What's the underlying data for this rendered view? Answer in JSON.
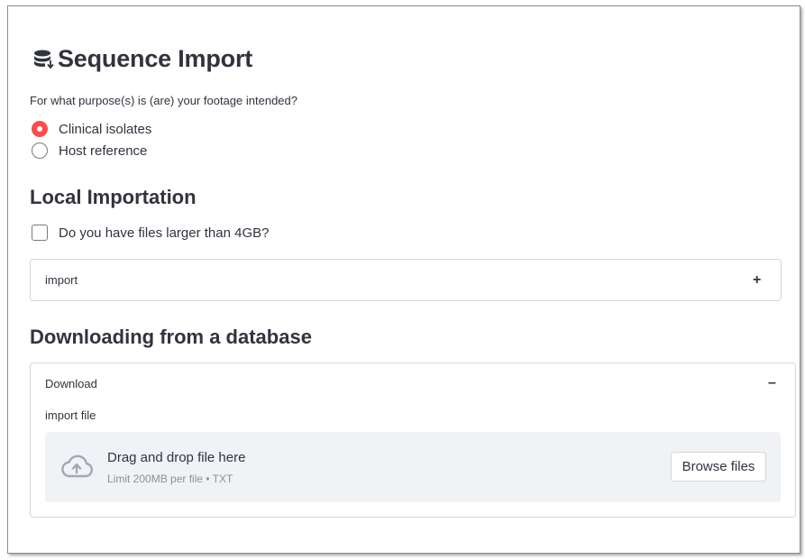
{
  "page": {
    "title": "Sequence Import",
    "title_icon": "database-import-icon"
  },
  "purpose": {
    "question": "For what purpose(s) is (are) your footage intended?",
    "options": [
      {
        "label": "Clinical isolates",
        "selected": true
      },
      {
        "label": "Host reference",
        "selected": false
      }
    ]
  },
  "local": {
    "heading": "Local Importation",
    "large_files_checkbox": {
      "label": "Do you have files larger than 4GB?",
      "checked": false
    },
    "import_expander": {
      "label": "import",
      "toggle": "+",
      "expanded": false
    }
  },
  "database": {
    "heading": "Downloading from a database",
    "download_expander": {
      "label": "Download",
      "toggle": "–",
      "expanded": true
    },
    "uploader": {
      "label": "import file",
      "drop_text": "Drag and drop file here",
      "limit_text": "Limit 200MB per file • TXT",
      "browse_label": "Browse files",
      "icon": "cloud-upload-icon"
    }
  },
  "colors": {
    "accent": "#ff4b4b",
    "text": "#31333f",
    "muted": "#8c8f99",
    "dropzone_bg": "#f0f2f6",
    "border": "#d6d6d9"
  }
}
